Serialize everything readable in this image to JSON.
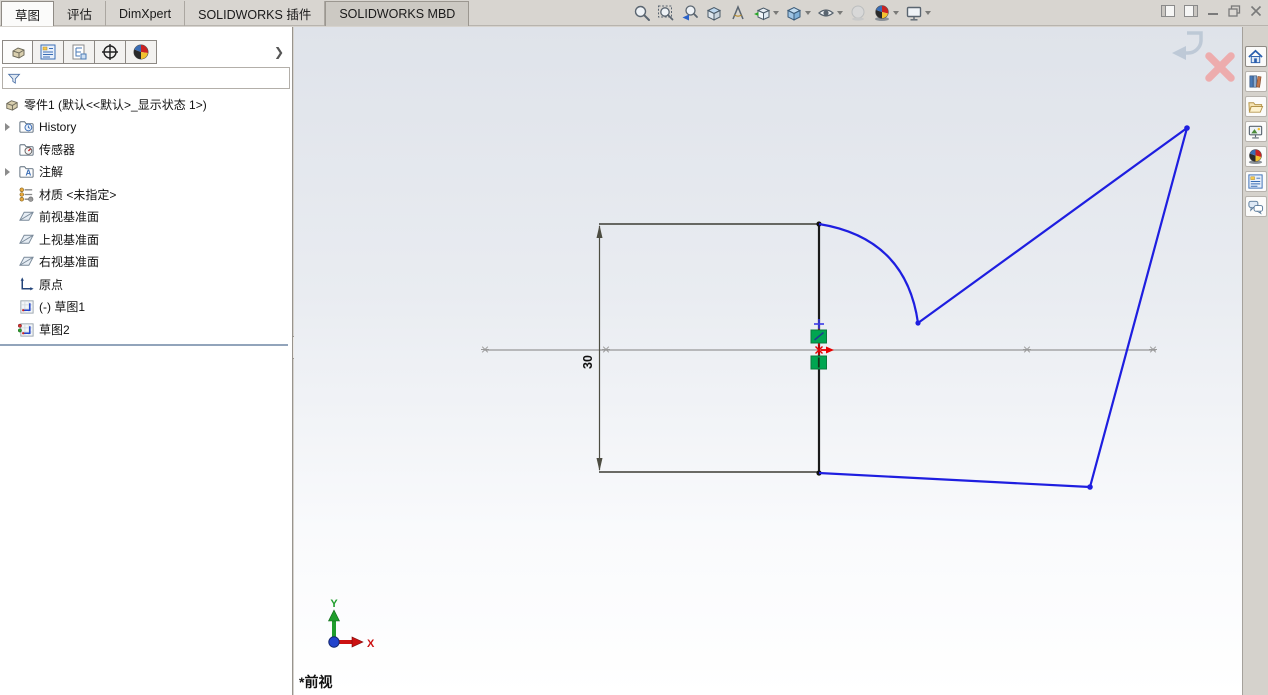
{
  "command_tabs": {
    "items": [
      {
        "label": "草图",
        "active": true
      },
      {
        "label": "评估",
        "active": false
      },
      {
        "label": "DimXpert",
        "active": false
      },
      {
        "label": "SOLIDWORKS 插件",
        "active": false
      },
      {
        "label": "SOLIDWORKS MBD",
        "active": false
      }
    ]
  },
  "headsup_toolbar": {
    "icons": [
      "zoom-to-fit",
      "zoom-to-area",
      "previous-view",
      "section-view",
      "3d-drawing-view",
      "view-orientation",
      "display-style",
      "hide-show-items",
      "edit-appearance",
      "apply-scene",
      "view-settings"
    ]
  },
  "window_controls": [
    "collapse-panel-left",
    "collapse-panel-right",
    "minimize",
    "restore",
    "close"
  ],
  "feature_panel": {
    "tab_icons": [
      "featuremanager-design-tree",
      "propertymanager",
      "configurationmanager",
      "dimxpertmanager",
      "displaymanager"
    ],
    "root": {
      "label": "零件1 (默认<<默认>_显示状态 1>)"
    },
    "tree": [
      {
        "label": "History",
        "icon": "history-folder",
        "expandable": true
      },
      {
        "label": "传感器",
        "icon": "sensors-folder",
        "expandable": false
      },
      {
        "label": "注解",
        "icon": "annotations-folder",
        "expandable": true
      },
      {
        "label": "材质 <未指定>",
        "icon": "material",
        "expandable": false
      },
      {
        "label": "前视基准面",
        "icon": "plane",
        "expandable": false
      },
      {
        "label": "上视基准面",
        "icon": "plane",
        "expandable": false
      },
      {
        "label": "右视基准面",
        "icon": "plane",
        "expandable": false
      },
      {
        "label": "原点",
        "icon": "origin",
        "expandable": false
      },
      {
        "label": "(-) 草图1",
        "icon": "sketch",
        "expandable": false
      },
      {
        "label": "草图2",
        "icon": "sketch-active",
        "expandable": false
      }
    ]
  },
  "task_pane": {
    "icons": [
      "home",
      "design-library",
      "file-explorer",
      "view-palette",
      "appearances-scenes",
      "custom-properties",
      "solidworks-forum"
    ]
  },
  "canvas": {
    "dimension_label": "30",
    "view_label": "*前视",
    "triad": {
      "x_label": "X",
      "y_label": "Y"
    },
    "sketch_colors": {
      "geometry_blue": "#1e1ee0",
      "line_black": "#1a1a1a",
      "dimension": "#4d4d42",
      "centerline": "#979797",
      "constraint_green": "#00a651",
      "origin_red": "#e80000"
    }
  }
}
